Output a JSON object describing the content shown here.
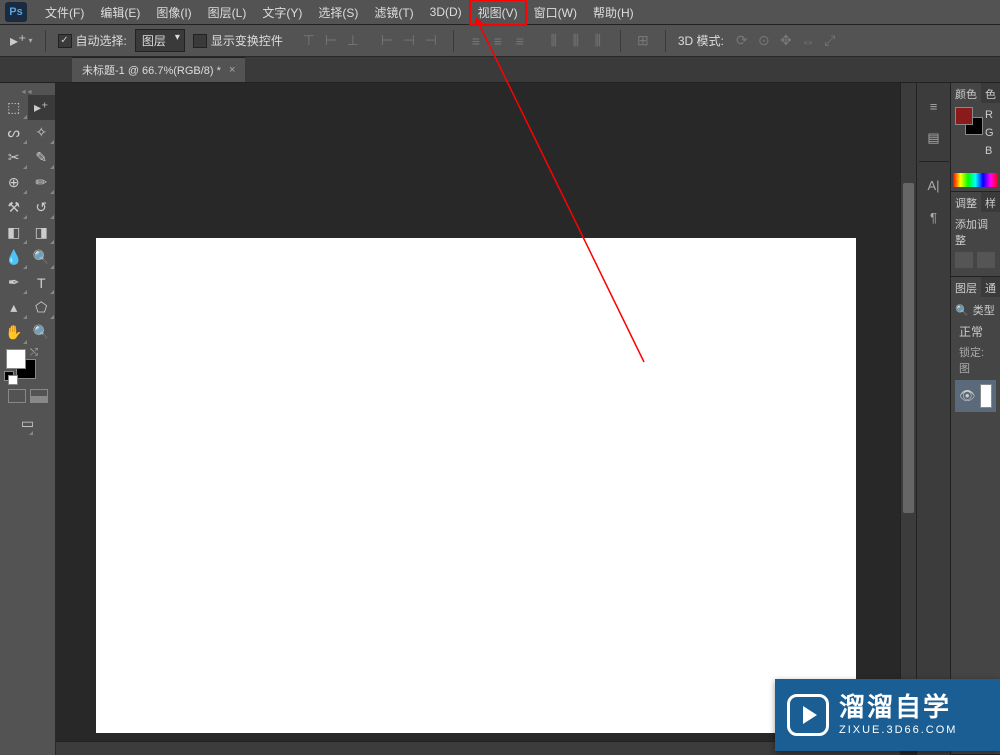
{
  "app": {
    "logo_text": "Ps"
  },
  "menu": {
    "file": "文件(F)",
    "edit": "编辑(E)",
    "image": "图像(I)",
    "layer": "图层(L)",
    "type": "文字(Y)",
    "select": "选择(S)",
    "filter": "滤镜(T)",
    "3d": "3D(D)",
    "view": "视图(V)",
    "window": "窗口(W)",
    "help": "帮助(H)"
  },
  "options": {
    "auto_select_label": "自动选择:",
    "auto_select_target": "图层",
    "show_transform_controls": "显示变换控件",
    "mode_3d_label": "3D 模式:"
  },
  "tab": {
    "title": "未标题-1 @ 66.7%(RGB/8) *"
  },
  "panels": {
    "color_tab": "颜色",
    "swatches_tab": "色",
    "r_label": "R",
    "g_label": "G",
    "b_label": "B",
    "adjust_tab": "调整",
    "adjust_extra": "样",
    "add_adjust_label": "添加调整",
    "layers_tab": "图层",
    "channels_tab": "通",
    "kind_label": "类型",
    "blend_mode": "正常",
    "lock_label": "锁定:",
    "lock_icons": "图"
  },
  "tools": {
    "move": "move-tool",
    "artboard": "artboard-tool",
    "lasso": "lasso-tool",
    "magic_wand": "magic-wand-tool",
    "crop": "crop-tool",
    "eyedropper": "eyedropper-tool",
    "healing": "healing-brush-tool",
    "brush": "brush-tool",
    "clone": "clone-stamp-tool",
    "history": "history-brush-tool",
    "eraser": "eraser-tool",
    "gradient": "gradient-tool",
    "blur": "blur-tool",
    "dodge": "dodge-tool",
    "pen": "pen-tool",
    "type": "type-tool",
    "path": "path-select-tool",
    "shape": "shape-tool",
    "hand": "hand-tool",
    "zoom": "zoom-tool"
  },
  "watermark": {
    "main": "溜溜自学",
    "sub": "ZIXUE.3D66.COM"
  }
}
